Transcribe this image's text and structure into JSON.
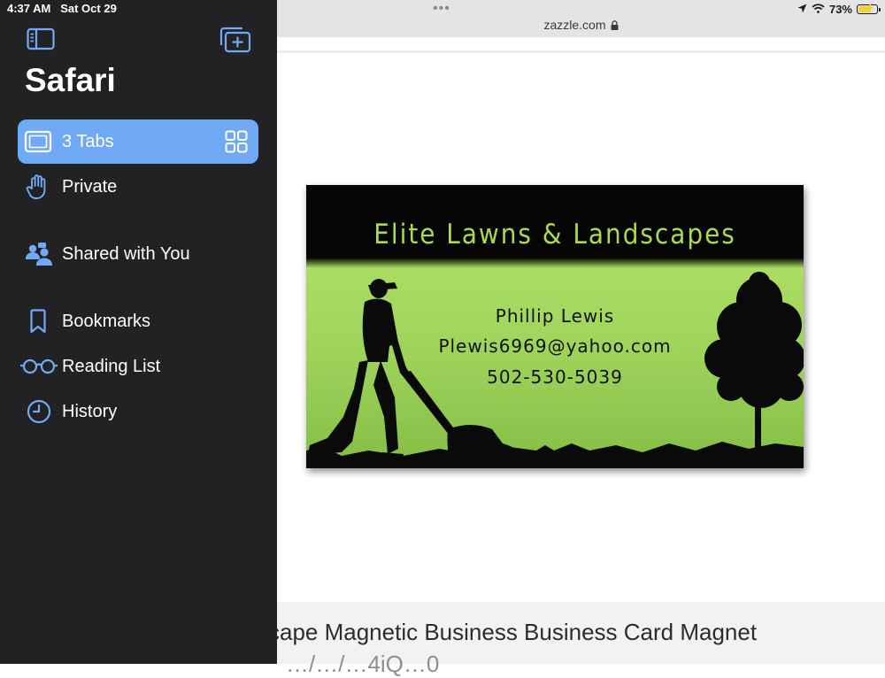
{
  "status_bar": {
    "time": "4:37 AM",
    "date": "Sat Oct 29",
    "battery_percent": "73%",
    "battery_level": 0.73
  },
  "browser": {
    "url": "zazzle.com",
    "more_dots": "•••"
  },
  "sidebar": {
    "app_title": "Safari",
    "items": [
      {
        "label": "3 Tabs",
        "icon": "tablet-icon",
        "selected": true
      },
      {
        "label": "Private",
        "icon": "hand-icon"
      },
      {
        "label": "Shared with You",
        "icon": "shared-people-icon"
      },
      {
        "label": "Bookmarks",
        "icon": "bookmark-icon"
      },
      {
        "label": "Reading List",
        "icon": "glasses-icon"
      },
      {
        "label": "History",
        "icon": "clock-icon"
      }
    ]
  },
  "card": {
    "title": "Elite Lawns & Landscapes",
    "name": "Phillip Lewis",
    "email": "Plewis6969@yahoo.com",
    "phone": "502-530-5039"
  },
  "product": {
    "title": "cape Magnetic Business Business Card Magnet",
    "subtitle": "…/…/…4iQ…0"
  },
  "colors": {
    "accent": "#70aaf7",
    "sidebar_bg": "#222224",
    "card_green": "#9fd05a"
  }
}
